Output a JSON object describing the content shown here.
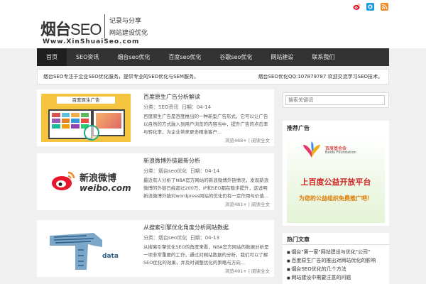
{
  "header": {
    "logo_cn": "烟台",
    "logo_seo": "SEO",
    "slogan_line1": "记录与分享",
    "slogan_line2": "网站建设优化",
    "url": "Www.XinShuaiSeo.com",
    "social_icons": [
      "weibo-icon",
      "qq-icon",
      "rss-icon"
    ],
    "colors": {
      "weibo": "#e6162d",
      "qq": "#1a9be6",
      "rss": "#f08a24"
    }
  },
  "nav": {
    "items": [
      "首页",
      "SEO资讯",
      "烟台seo优化",
      "百度seo优化",
      "谷歌seo优化",
      "网站建设",
      "联系我们"
    ]
  },
  "notice": {
    "left_text": "烟台SEO专注于企业SEO优化服务，提供专业的SEO优化与SEM服务。",
    "right_text": "烟台SEO优化QQ:107879787 欢迎交流学习SEO技术。"
  },
  "posts": [
    {
      "title": "百度原生广告分析解读",
      "category": "分类：SEO资讯",
      "date": "日期：04-14",
      "excerpt": "百度原生广告是百度推出的一种新型广告形式，它可以让广告以自然的方式融入到用户浏览的内容当中，提升广告的点击率与转化率，为企业带来更多精准客户...",
      "views": "浏览468+",
      "more": "阅读全文",
      "thumb_label": "百度原生广告"
    },
    {
      "title": "新浪微博外链最新分析",
      "category": "分类：烟台seo优化",
      "date": "日期：04-14",
      "excerpt": "最近有人分析了NBA官方网站的新浪微博外链情况，发现新浪微博的外链已经超过200万，IP和SEO都在稳步提升，这说明新浪微博外链对wordpress网站的优化仍有一定作用与价值...",
      "views": "浏览481+",
      "more": "阅读全文",
      "thumb_label": "新浪微博",
      "thumb_sub": "weibo.com"
    },
    {
      "title": "从搜索引擎优化角度分析网站数据",
      "category": "分类：烟台seo优化",
      "date": "日期：04-13",
      "excerpt": "从搜索引擎优化SEO的角度来看，NBA官方网站的数据分析是一项非常重要的工作，通过对网站数据的分析，我们可以了解SEO优化的效果，并及时调整优化的策略与方向...",
      "views": "浏览491+",
      "more": "阅读全文",
      "thumb_label": "data"
    }
  ],
  "sidebar": {
    "search_placeholder": "搜索关键词",
    "ad_title": "推荐广告",
    "ad_foundation": "百度基金会",
    "ad_foundation_en": "Baidu Foundation",
    "ad_headline": "上百度公益开放平台",
    "ad_sub": "为您的公益组织免费推广吧！",
    "links_title": "热门文章",
    "links": [
      "烟台\"第一家\"网站建设与优化\"公司\"",
      "百度原生广告的推出对网站优化的影响",
      "烟台SEO优化的几个方法",
      "网站建设中需要注意的问题"
    ]
  }
}
